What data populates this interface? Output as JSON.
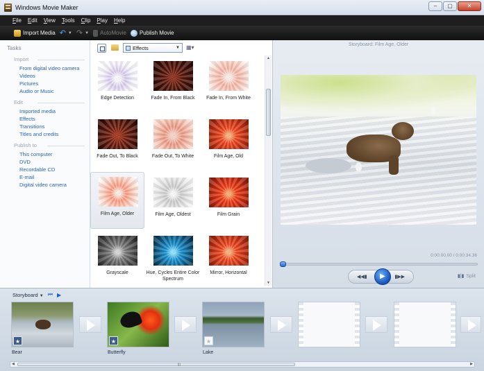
{
  "window": {
    "title": "Windows Movie Maker",
    "buttons": [
      "–",
      "▢",
      "✕"
    ]
  },
  "menu": [
    "File",
    "Edit",
    "View",
    "Tools",
    "Clip",
    "Play",
    "Help"
  ],
  "toolbar": {
    "import_label": "Import Media",
    "automovie_label": "AutoMovie",
    "publish_label": "Publish Movie"
  },
  "tasks": {
    "title": "Tasks",
    "sections": [
      {
        "heading": "Import",
        "links": [
          "From digital video camera",
          "Videos",
          "Pictures",
          "Audio or Music"
        ]
      },
      {
        "heading": "Edit",
        "links": [
          "Imported media",
          "Effects",
          "Transitions",
          "Titles and credits"
        ]
      },
      {
        "heading": "Publish to",
        "links": [
          "This computer",
          "DVD",
          "Recordable CD",
          "E-mail",
          "Digital video camera"
        ]
      }
    ]
  },
  "effects": {
    "dropdown_value": "Effects",
    "tiles": [
      {
        "label": "Edge Detection"
      },
      {
        "label": "Fade In, From Black"
      },
      {
        "label": "Fade In, From White"
      },
      {
        "label": "Fade Out, To Black"
      },
      {
        "label": "Fade Out, To White"
      },
      {
        "label": "Film Age, Old"
      },
      {
        "label": "Film Age, Older"
      },
      {
        "label": "Film Age, Oldest"
      },
      {
        "label": "Film Grain"
      },
      {
        "label": "Grayscale"
      },
      {
        "label": "Hue, Cycles Entire Color Spectrum"
      },
      {
        "label": "Mirror, Horizontal"
      }
    ],
    "selected": "Film Age, Older"
  },
  "preview": {
    "title": "Storyboard: Film Age, Older",
    "time": "0:00:00.00 / 0:00:34.36",
    "seek_position": 0.0,
    "split_label": "Split"
  },
  "storyboard": {
    "label": "Storyboard",
    "clips": [
      {
        "name": "Bear",
        "has_effect": true
      },
      {
        "name": "Butterfly",
        "has_effect": true
      },
      {
        "name": "Lake",
        "has_effect": false
      }
    ]
  }
}
